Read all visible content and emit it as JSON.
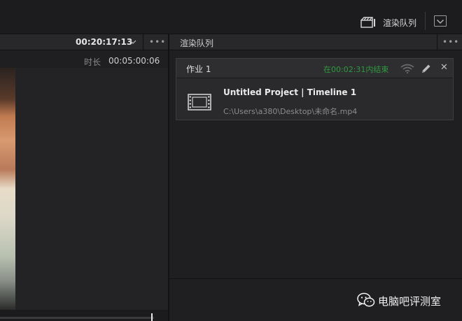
{
  "top_bar": {
    "render_queue_label": "渲染队列",
    "render_icon": "clapperboard-icon",
    "dropdown_icon": "chevron-down-box-icon"
  },
  "viewer": {
    "timecode": "00:20:17:13",
    "more_label": "•••",
    "duration_label": "时长",
    "duration_value": "00:05:00:06"
  },
  "render_queue": {
    "title": "渲染队列",
    "more_label": "•••",
    "jobs": [
      {
        "label": "作业 1",
        "status": "在00:02:31内结束",
        "status_color": "#2f9a3f",
        "name": "Untitled Project | Timeline 1",
        "path": "C:\\Users\\a380\\Desktop\\未命名.mp4",
        "close_label": "✕",
        "icons": [
          "wifi-icon",
          "pencil-icon",
          "close-icon",
          "film-strip-icon"
        ]
      }
    ]
  },
  "watermark": {
    "text": "电脑吧评测室",
    "icon": "wechat-icon"
  }
}
